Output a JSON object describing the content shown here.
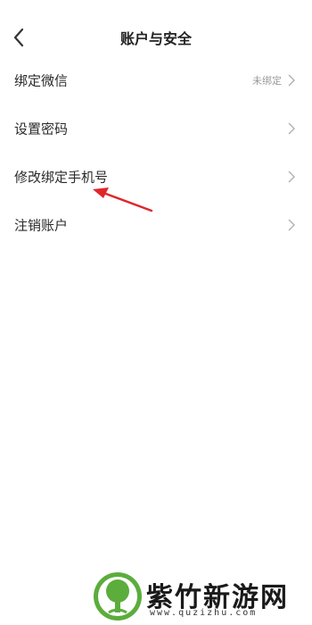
{
  "header": {
    "title": "账户与安全",
    "back_icon": "chevron-left-icon"
  },
  "settings": [
    {
      "label": "绑定微信",
      "value": "未绑定",
      "icon": "chevron-right-icon"
    },
    {
      "label": "设置密码",
      "value": "",
      "icon": "chevron-right-icon"
    },
    {
      "label": "修改绑定手机号",
      "value": "",
      "icon": "chevron-right-icon"
    },
    {
      "label": "注销账户",
      "value": "",
      "icon": "chevron-right-icon"
    }
  ],
  "annotation": {
    "icon": "red-arrow-icon",
    "color": "#e0262b"
  },
  "watermark": {
    "name": "紫竹新游网",
    "url": "www.quzizhu.com",
    "logo_icon": "tree-logo-icon",
    "logo_color": "#5cad3c"
  }
}
